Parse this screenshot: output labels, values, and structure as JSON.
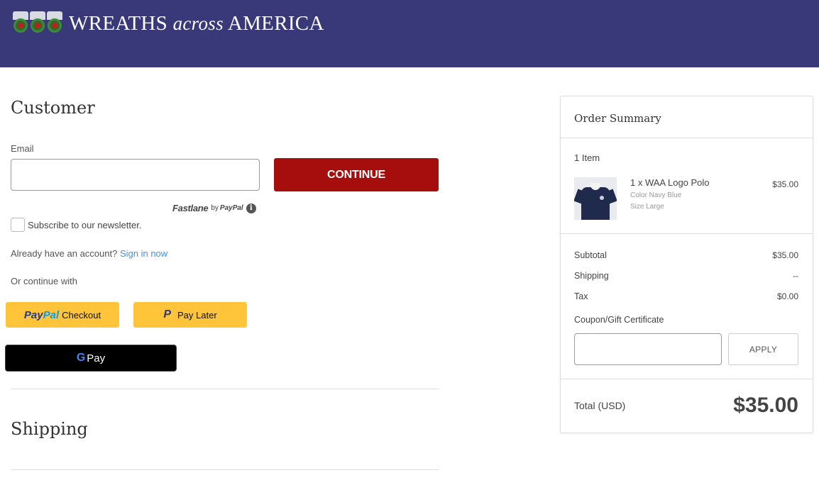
{
  "header": {
    "logo_prefix": "WREATHS ",
    "logo_italic": "across",
    "logo_suffix": " AMERICA",
    "background": "#39397a"
  },
  "customer": {
    "title": "Customer",
    "email_label": "Email",
    "email_value": "",
    "continue_label": "CONTINUE",
    "fastlane_brand": "Fastlane",
    "fastlane_by": "by",
    "fastlane_paypal": "PayPal",
    "info_symbol": "i",
    "newsletter_label": "Subscribe to our newsletter.",
    "newsletter_checked": false,
    "account_prompt": "Already have an account?",
    "sign_in_label": "Sign in now",
    "or_continue": "Or continue with",
    "paypal_checkout": {
      "word_a": "Pay",
      "word_b": "Pal",
      "suffix": "Checkout"
    },
    "paypal_later": {
      "mark": "P",
      "label": "Pay Later"
    },
    "gpay": {
      "g": "G",
      "label": "Pay"
    },
    "accent_color": "#a60e0e",
    "paypal_color": "#ffc439"
  },
  "shipping": {
    "title": "Shipping"
  },
  "summary": {
    "title": "Order Summary",
    "item_count": "1 Item",
    "item": {
      "name": "1 x WAA Logo Polo",
      "color": "Color Navy Blue",
      "size": "Size Large",
      "price": "$35.00"
    },
    "subtotal_label": "Subtotal",
    "subtotal_value": "$35.00",
    "shipping_label": "Shipping",
    "shipping_value": "--",
    "tax_label": "Tax",
    "tax_value": "$0.00",
    "coupon_label": "Coupon/Gift Certificate",
    "coupon_value": "",
    "apply_label": "APPLY",
    "total_label": "Total (USD)",
    "total_value": "$35.00"
  }
}
